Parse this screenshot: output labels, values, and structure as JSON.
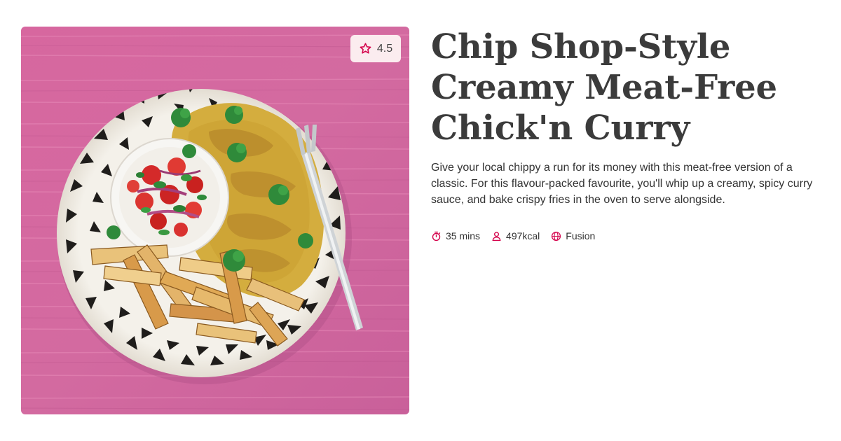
{
  "rating": {
    "value": "4.5",
    "icon": "star-outline-icon",
    "accent": "#d4004a",
    "badge_bg": "#fbecef"
  },
  "recipe": {
    "title": "Chip Shop-Style Creamy Meat-Free Chick'n Curry",
    "description": "Give your local chippy a run for its money with this meat-free version of a classic. For this flavour-packed favourite, you'll whip up a creamy, spicy curry sauce, and bake crispy fries in the oven to serve alongside."
  },
  "meta": {
    "time": {
      "label": "35 mins",
      "icon": "stopwatch-icon"
    },
    "calories": {
      "label": "497kcal",
      "icon": "person-icon"
    },
    "cuisine": {
      "label": "Fusion",
      "icon": "globe-icon"
    }
  },
  "image": {
    "subject": "curry-plate-photo",
    "background_color": "#d56aa0",
    "accent_color": "#d4004a"
  }
}
